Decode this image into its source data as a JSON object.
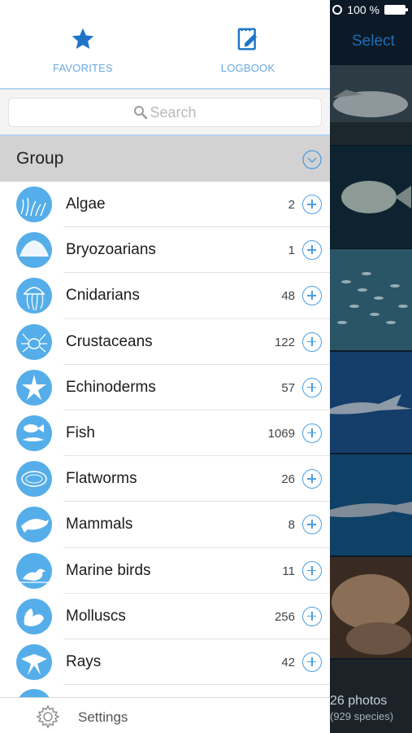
{
  "status": {
    "battery": "100 %"
  },
  "background": {
    "select_label": "Select",
    "photo_count": "26 photos",
    "species_count": "(929 species)"
  },
  "tabs": [
    {
      "label": "FAVORITES",
      "icon": "star-icon"
    },
    {
      "label": "LOGBOOK",
      "icon": "logbook-icon"
    }
  ],
  "search": {
    "placeholder": "Search"
  },
  "group": {
    "title": "Group"
  },
  "groups": [
    {
      "name": "Algae",
      "count": "2",
      "icon": "algae-icon"
    },
    {
      "name": "Bryozoarians",
      "count": "1",
      "icon": "bryozoarian-icon"
    },
    {
      "name": "Cnidarians",
      "count": "48",
      "icon": "jellyfish-icon"
    },
    {
      "name": "Crustaceans",
      "count": "122",
      "icon": "crab-icon"
    },
    {
      "name": "Echinoderms",
      "count": "57",
      "icon": "starfish-icon"
    },
    {
      "name": "Fish",
      "count": "1069",
      "icon": "fish-icon"
    },
    {
      "name": "Flatworms",
      "count": "26",
      "icon": "flatworm-icon"
    },
    {
      "name": "Mammals",
      "count": "8",
      "icon": "dolphin-icon"
    },
    {
      "name": "Marine birds",
      "count": "11",
      "icon": "bird-icon"
    },
    {
      "name": "Molluscs",
      "count": "256",
      "icon": "mollusc-icon"
    },
    {
      "name": "Rays",
      "count": "42",
      "icon": "ray-icon"
    }
  ],
  "footer": {
    "settings_label": "Settings",
    "icon": "gear-icon"
  },
  "colors": {
    "accent": "#4a9ee3",
    "icon_bg": "#55aee9",
    "select": "#1e6fb8"
  }
}
